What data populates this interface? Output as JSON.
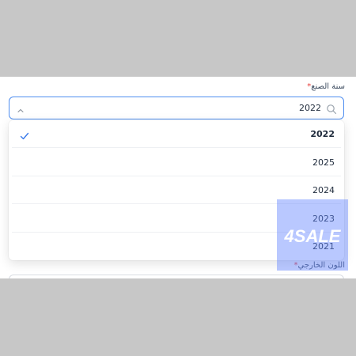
{
  "form": {
    "year_field": {
      "label": "سنة الصنع",
      "required_mark": "*",
      "selected_value": "2022",
      "options": [
        {
          "label": "2022",
          "selected": true
        },
        {
          "label": "2025",
          "selected": false
        },
        {
          "label": "2024",
          "selected": false
        },
        {
          "label": "2023",
          "selected": false
        },
        {
          "label": "2021",
          "selected": false
        }
      ]
    },
    "color_field": {
      "label": "اللون الخارجي",
      "required_mark": "*"
    }
  },
  "watermark": {
    "text": "4SALE"
  },
  "colors": {
    "accent": "#4f8ef0",
    "required": "#e53935",
    "overlay": "#c7c7c7",
    "watermark": "#6384ff"
  },
  "icons": {
    "search": "search-icon",
    "chevron": "chevron-up-icon",
    "check": "check-icon"
  }
}
